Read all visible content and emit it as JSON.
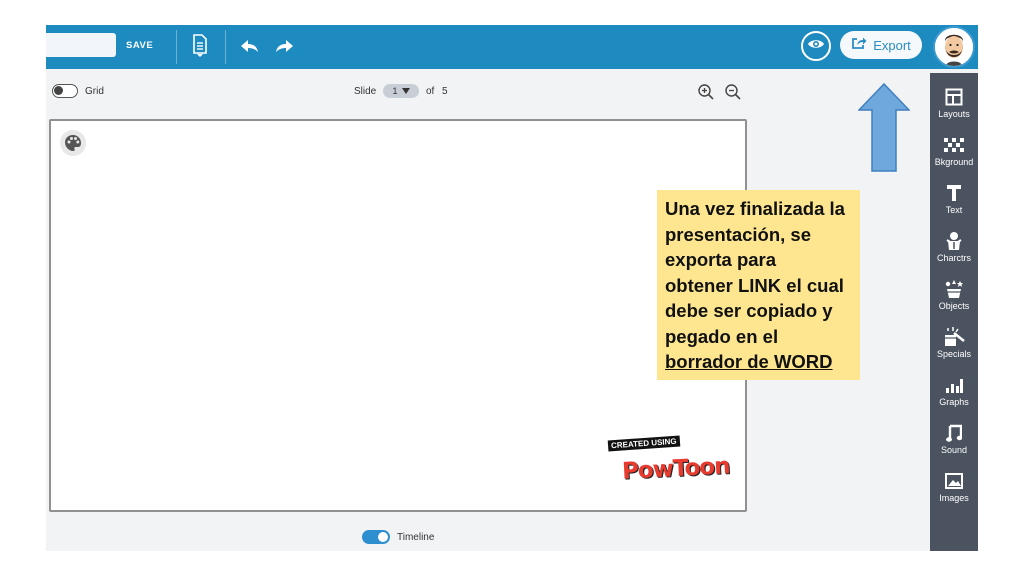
{
  "toolbar": {
    "save_label": "SAVE",
    "export_label": "Export",
    "icons": [
      "document-icon",
      "undo-icon",
      "redo-icon",
      "eye-icon",
      "export-icon"
    ]
  },
  "canvas_toolbar": {
    "grid_label": "Grid",
    "slide_label": "Slide",
    "slide_current": "1",
    "slide_of": "of",
    "slide_total": "5"
  },
  "sidebar": {
    "items": [
      {
        "label": "Layouts",
        "icon": "layouts-icon"
      },
      {
        "label": "Bkground",
        "icon": "background-icon"
      },
      {
        "label": "Text",
        "icon": "text-icon"
      },
      {
        "label": "Charctrs",
        "icon": "characters-icon"
      },
      {
        "label": "Objects",
        "icon": "objects-icon"
      },
      {
        "label": "Specials",
        "icon": "specials-icon"
      },
      {
        "label": "Graphs",
        "icon": "graphs-icon"
      },
      {
        "label": "Sound",
        "icon": "sound-icon"
      },
      {
        "label": "Images",
        "icon": "images-icon"
      }
    ]
  },
  "watermark": {
    "created_using": "CREATED USING",
    "brand": "PowToon"
  },
  "timeline": {
    "label": "Timeline",
    "enabled": true
  },
  "annotation": {
    "lines": [
      "Una vez finalizada la",
      "presentación, se",
      "exporta para",
      "obtener LINK el cual",
      "debe ser copiado y",
      "pegado en el",
      "borrador de WORD"
    ]
  },
  "colors": {
    "topbar": "#1d8ac0",
    "sidebar": "#4a535f",
    "note_bg": "#fde68f",
    "arrow": "#6fa8dc"
  }
}
